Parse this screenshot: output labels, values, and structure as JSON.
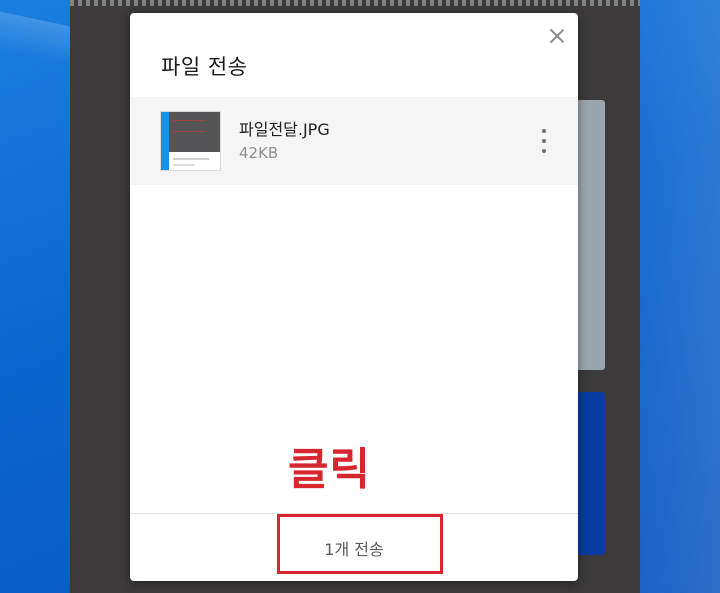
{
  "dialog": {
    "title": "파일 전송",
    "file": {
      "name": "파일전달.JPG",
      "size": "42KB"
    },
    "send_button_label": "1개 전송"
  },
  "annotation": {
    "text": "클릭",
    "color": "#d7262d"
  },
  "colors": {
    "desktop_blue": "#0b64cf",
    "app_background": "#3c3a3b",
    "dialog_background": "#ffffff"
  },
  "icons": {
    "close": "close-icon",
    "more": "more-vertical-icon",
    "file_thumbnail": "image-thumbnail-icon"
  }
}
